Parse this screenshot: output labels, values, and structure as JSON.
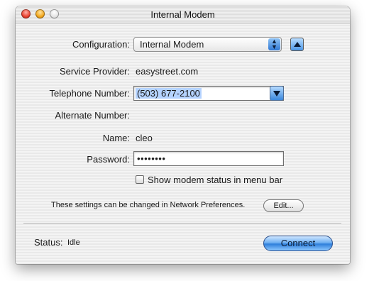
{
  "window": {
    "title": "Internal Modem"
  },
  "configuration": {
    "label": "Configuration:",
    "value": "Internal Modem"
  },
  "service_provider": {
    "label": "Service Provider:",
    "value": "easystreet.com"
  },
  "telephone": {
    "label": "Telephone Number:",
    "value": "(503) 677-2100"
  },
  "alternate": {
    "label": "Alternate Number:",
    "value": ""
  },
  "name": {
    "label": "Name:",
    "value": "cleo"
  },
  "password": {
    "label": "Password:",
    "masked_value": "••••••••"
  },
  "show_status": {
    "label": "Show modem status in menu bar",
    "checked": false
  },
  "note": {
    "text": "These settings can be changed in Network Preferences.",
    "edit_label": "Edit..."
  },
  "status": {
    "label": "Status:",
    "value": "Idle"
  },
  "connect": {
    "label": "Connect"
  },
  "colors": {
    "accent": "#2f7fdb",
    "selection": "#b5d3ff"
  }
}
